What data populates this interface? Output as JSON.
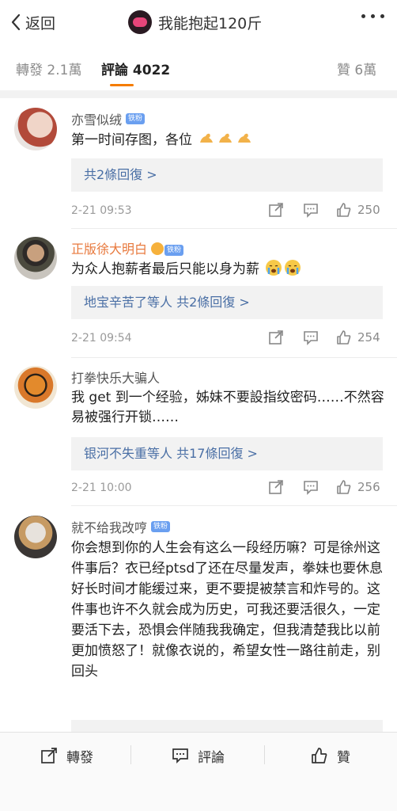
{
  "nav": {
    "back_label": "返回",
    "title": "我能抱起120斤"
  },
  "tabs": {
    "repost": "轉發 2.1萬",
    "comments": "評論 4022",
    "likes": "贊 6萬"
  },
  "comments": [
    {
      "username": "亦雪似绒",
      "badge": "铁粉",
      "text": "第一时间存图，各位",
      "emoji": "flex-arm-emoji",
      "reply_link": "共2條回復 >",
      "time": "2-21 09:53",
      "likes": "250"
    },
    {
      "username": "正版徐大明白",
      "badge": "铁粉",
      "text": "为众人抱薪者最后只能以身为薪",
      "emoji": "crying-face-emoji",
      "reply_link": "地宝辛苦了等人 共2條回復 >",
      "time": "2-21 09:54",
      "likes": "254"
    },
    {
      "username": "打拳快乐大骗人",
      "text": "我 get 到一个经验，姊妹不要設指纹密码……不然容易被强行开锁……",
      "reply_link": "银河不失重等人 共17條回復 >",
      "time": "2-21 10:00",
      "likes": "256"
    },
    {
      "username": "就不给我改哼",
      "badge": "铁粉",
      "text": "你会想到你的人生会有这么一段经历嘛？可是徐州这件事后？衣已经ptsd了还在尽量发声，拳妹也要休息好长时间才能缓过来，更不要提被禁言和炸号的。这件事也许不久就会成为历史，可我还要活很久，一定要活下去，恐惧会伴随我我确定，但我清楚我比以前更加愤怒了！就像衣说的，希望女性一路往前走，别回头"
    }
  ],
  "bottom": {
    "repost": "轉發",
    "comment": "評論",
    "like": "贊"
  },
  "colors": {
    "accent": "#f57c00",
    "link": "#4a6fa5",
    "vip_name": "#e8793d",
    "badge": "#6a9ff0"
  }
}
